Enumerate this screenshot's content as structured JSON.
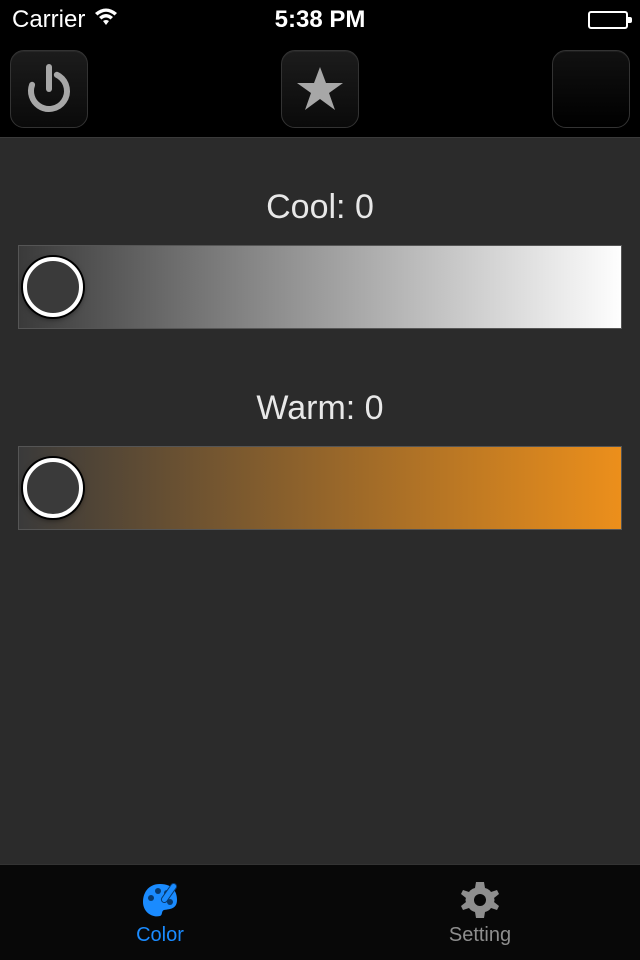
{
  "status": {
    "carrier": "Carrier",
    "time": "5:38 PM"
  },
  "toolbar": {
    "power_name": "power",
    "favorite_name": "favorite",
    "blank_name": "blank"
  },
  "sliders": {
    "cool": {
      "label_prefix": "Cool: ",
      "value": 0
    },
    "warm": {
      "label_prefix": "Warm: ",
      "value": 0
    }
  },
  "tabs": {
    "color": "Color",
    "setting": "Setting"
  }
}
